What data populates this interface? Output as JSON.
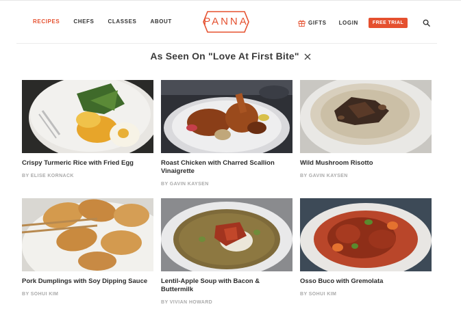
{
  "nav": {
    "recipes": "RECIPES",
    "chefs": "CHEFS",
    "classes": "CLASSES",
    "about": "ABOUT",
    "gifts": "GIFTS",
    "login": "LOGIN",
    "free_trial": "FREE TRIAL"
  },
  "logo": "PANNA",
  "page_title": "As Seen On \"Love At First Bite\"",
  "colors": {
    "accent": "#e5502f"
  },
  "recipes": [
    {
      "title": "Crispy Turmeric Rice with Fried Egg",
      "author": "by ELISE KORNACK"
    },
    {
      "title": "Roast Chicken with Charred Scallion Vinaigrette",
      "author": "by GAVIN KAYSEN"
    },
    {
      "title": "Wild Mushroom Risotto",
      "author": "by GAVIN KAYSEN"
    },
    {
      "title": "Pork Dumplings with Soy Dipping Sauce",
      "author": "by SOHUI KIM"
    },
    {
      "title": "Lentil-Apple Soup with Bacon & Buttermilk",
      "author": "by VIVIAN HOWARD"
    },
    {
      "title": "Osso Buco with Gremolata",
      "author": "by SOHUI KIM"
    }
  ]
}
